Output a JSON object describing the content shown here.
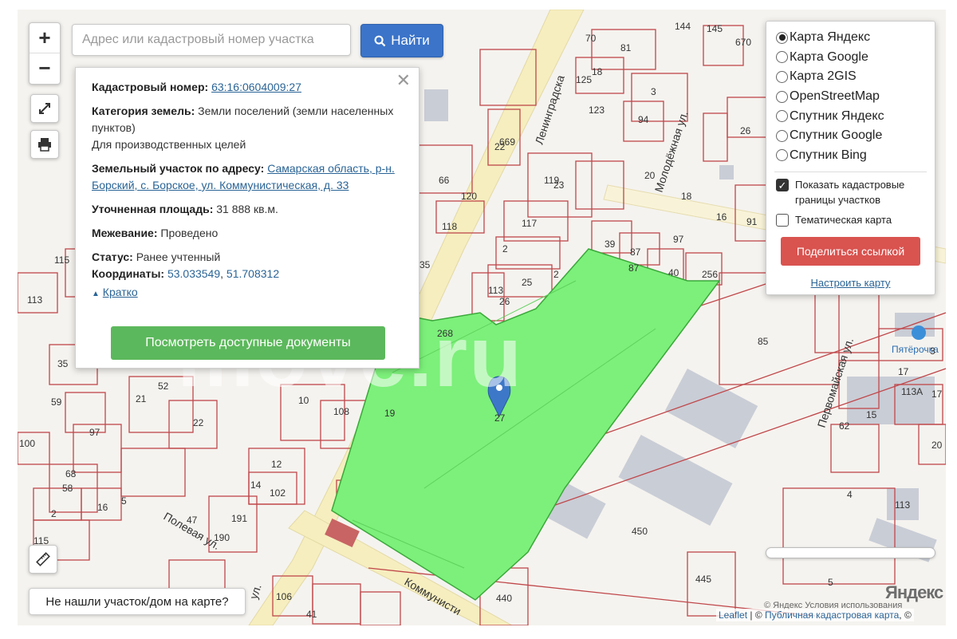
{
  "search": {
    "placeholder": "Адрес или кадастровый номер участка",
    "button_label": "Найти"
  },
  "zoom": {
    "in_label": "+",
    "out_label": "−"
  },
  "popup": {
    "cadastral_label": "Кадастровый номер:",
    "cadastral_value": "63:16:0604009:27",
    "category_label": "Категория земель:",
    "category_value": "Земли поселений (земли населенных пунктов)",
    "usage_value": "Для производственных целей",
    "address_label": "Земельный участок по адресу:",
    "address_value": "Самарская область, р-н. Борский, с. Борское, ул. Коммунистическая, д. 33",
    "area_label": "Уточненная площадь:",
    "area_value": "31 888 кв.м.",
    "survey_label": "Межевание:",
    "survey_value": "Проведено",
    "status_label": "Статус:",
    "status_value": "Ранее учтенный",
    "coords_label": "Координаты:",
    "coord_lat": "53.033549",
    "coord_sep": ",",
    "coord_lon": "51.708312",
    "collapse_link": "Кратко",
    "docs_button": "Посмотреть доступные документы",
    "close_symbol": "✕"
  },
  "layers": {
    "base_maps": [
      {
        "label": "Карта Яндекс",
        "selected": true
      },
      {
        "label": "Карта Google",
        "selected": false
      },
      {
        "label": "Карта 2GIS",
        "selected": false
      },
      {
        "label": "OpenStreetMap",
        "selected": false
      },
      {
        "label": "Спутник Яндекс",
        "selected": false
      },
      {
        "label": "Спутник Google",
        "selected": false
      },
      {
        "label": "Спутник Bing",
        "selected": false
      }
    ],
    "show_borders_label": "Показать кадастровые границы участков",
    "show_borders_checked": true,
    "thematic_label": "Тематическая карта",
    "thematic_checked": false,
    "share_button": "Поделиться ссылкой",
    "configure_link": "Настроить карту"
  },
  "bottom": {
    "not_found_button": "Не нашли участок/дом на карте?"
  },
  "attribution": {
    "leaflet": "Leaflet",
    "separator": " | © ",
    "pkk": "Публичная кадастровая карта",
    "tail": ", ©",
    "yandex_logo": "Яндекс",
    "yandex_terms": "© Яндекс Условия использования"
  },
  "watermark": "move.ru",
  "map": {
    "streets": {
      "leningradskaya": "Ленинградска",
      "molodezhnaya": "Молодёжная ул.",
      "pervomayskaya": "Первомайская ул.",
      "polevaya": "Полевая ул.",
      "kommunisticheskaya": "Коммунисти",
      "gagarina_part": "ул."
    },
    "poi": {
      "pyaterochka": "Пятёрочка"
    },
    "marker_plot_label": "27",
    "plot_numbers": [
      "144",
      "145",
      "670",
      "70",
      "81",
      "18",
      "125",
      "3",
      "123",
      "94",
      "26",
      "669",
      "22",
      "119",
      "23",
      "20",
      "18",
      "16",
      "91",
      "66",
      "120",
      "118",
      "117",
      "39",
      "87",
      "87",
      "40",
      "97",
      "256",
      "2",
      "2",
      "25",
      "113",
      "26",
      "115",
      "113",
      "35",
      "268",
      "85",
      "3",
      "17",
      "113А",
      "17",
      "15",
      "62",
      "20",
      "35",
      "52",
      "21",
      "59",
      "10",
      "108",
      "19",
      "22",
      "97",
      "100",
      "12",
      "14",
      "102",
      "68",
      "58",
      "2",
      "115",
      "5",
      "47",
      "191",
      "190",
      "450",
      "4",
      "113",
      "5",
      "445",
      "106",
      "41",
      "440",
      "16"
    ],
    "colors": {
      "parcel_border": "#c0474a",
      "selected_parcel": "#7cf07a",
      "road": "#f6eebf",
      "building": "#c9cdd6"
    }
  }
}
